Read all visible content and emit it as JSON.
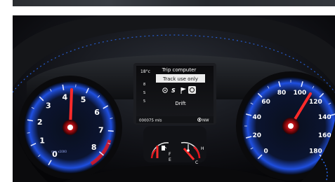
{
  "trip_computer": {
    "title": "Trip computer",
    "subtitle": "Track use only",
    "mode_label": "Drift",
    "odometer": "000075 mls",
    "compass": "NW",
    "outside_temp": "18°c",
    "side_labels": [
      "8",
      "S",
      "5"
    ]
  },
  "tachometer": {
    "ticks": [
      "0",
      "1",
      "2",
      "3",
      "4",
      "5",
      "6",
      "7",
      "8"
    ],
    "unit_label": "rpm x1000"
  },
  "speedometer": {
    "ticks": [
      "0",
      "20",
      "40",
      "60",
      "80",
      "100",
      "120",
      "140",
      "160",
      "180"
    ]
  },
  "fuel_gauge": {
    "empty": "E",
    "full": "F"
  },
  "temp_gauge": {
    "cold": "C",
    "hot": "H"
  },
  "colors": {
    "blue_glow": "#2d6bff",
    "needle_red": "#e0141c",
    "display_white": "#f2f2f2"
  },
  "icons": [
    "fuel-pump-icon",
    "coolant-temperature-icon",
    "gear-icon",
    "flag-icon",
    "drift-mode-icon",
    "compass-icon"
  ]
}
